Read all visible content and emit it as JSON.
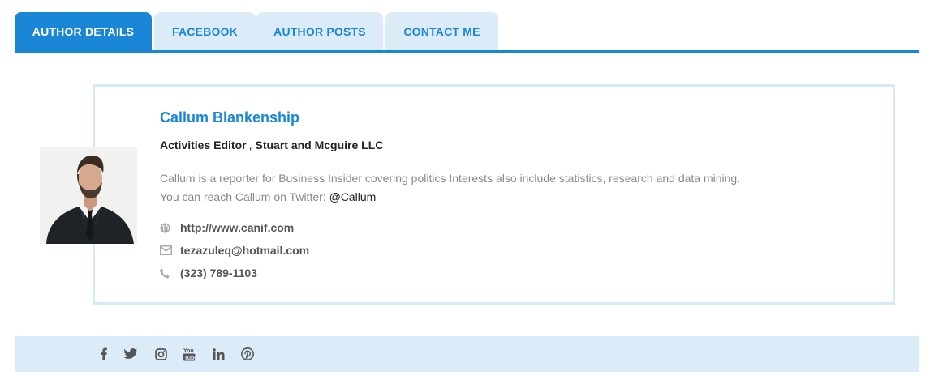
{
  "tabs": [
    {
      "label": "AUTHOR DETAILS",
      "active": true
    },
    {
      "label": "FACEBOOK",
      "active": false
    },
    {
      "label": "AUTHOR POSTS",
      "active": false
    },
    {
      "label": "CONTACT ME",
      "active": false
    }
  ],
  "author": {
    "name": "Callum Blankenship",
    "title": "Activities Editor",
    "separator": ",",
    "company": "Stuart and Mcguire LLC",
    "bio_line1": "Callum is a reporter for Business Insider covering politics Interests also include statistics, research and data mining.",
    "bio_line2_prefix": "You can reach Callum on Twitter: ",
    "twitter_handle": "@Callum",
    "website": "http://www.canif.com",
    "email": "tezazuleq@hotmail.com",
    "phone": "(323) 789-1103"
  },
  "icons": {
    "website": "globe-icon",
    "email": "envelope-icon",
    "phone": "phone-icon"
  },
  "social_icons": [
    "facebook-icon",
    "twitter-icon",
    "instagram-icon",
    "youtube-icon",
    "linkedin-icon",
    "pinterest-icon"
  ],
  "colors": {
    "accent": "#1a87d6",
    "tab_inactive_bg": "#dcebf8",
    "card_border": "#d6e9f6",
    "social_bar_bg": "#dcebf8"
  }
}
